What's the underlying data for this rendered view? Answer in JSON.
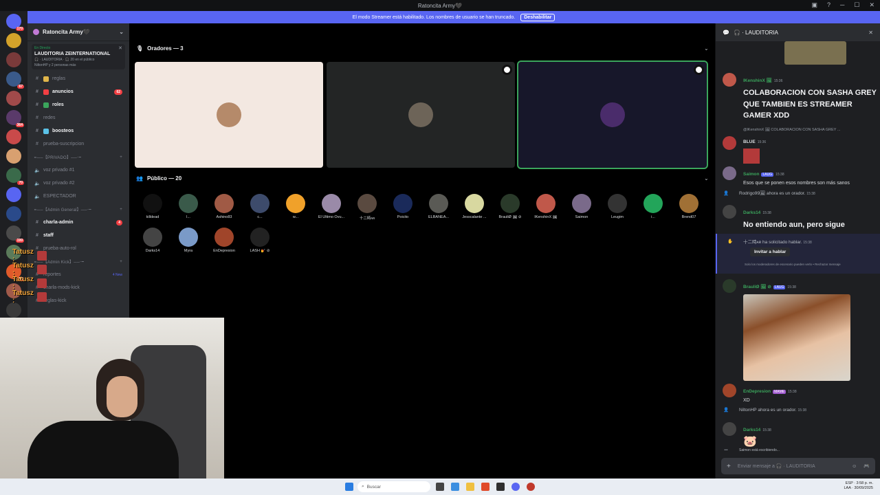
{
  "titlebar": {
    "title": "Ratoncita Army🖤"
  },
  "streamer_banner": {
    "text": "El modo Streamer está habilitado. Los nombres de usuario se han truncado.",
    "button": "Deshabilitar"
  },
  "guild_badges": [
    "170",
    "",
    "",
    "67",
    "",
    "364",
    "",
    "",
    "70",
    "",
    "",
    "199",
    "",
    "19",
    "",
    ""
  ],
  "server": {
    "name": "Ratoncita Army🖤",
    "live_label": "En Directo",
    "stage_title": "LAUDITORIA ZEINTERNATIONAL",
    "stage_sub": "🎧 · LAUDITORIA · 🎧 20 en el público",
    "stage_people": "NiltonHP y 2 personas más"
  },
  "channels": [
    {
      "name": "reglas",
      "bright": false,
      "color": "#e0b54a",
      "count": ""
    },
    {
      "name": "anuncios",
      "bright": true,
      "color": "#f23f43",
      "count": "62"
    },
    {
      "name": "roles",
      "bright": true,
      "color": "#3ba55c",
      "count": ""
    },
    {
      "name": "redes",
      "bright": false,
      "color": "",
      "count": ""
    },
    {
      "name": "boosteos",
      "bright": true,
      "color": "#5bc2e7",
      "count": ""
    },
    {
      "name": "prueba-suscripcion",
      "bright": false,
      "color": "",
      "count": ""
    }
  ],
  "cat_privado": "╾──【PRIVADO】──╼",
  "voice_channels": [
    {
      "name": "voz privado #1"
    },
    {
      "name": "voz privado #2"
    },
    {
      "name": "ESPECTADOR"
    }
  ],
  "cat_admin": "╾──【Admin General】──╼",
  "admin_channels": [
    {
      "name": "charla-admin",
      "bright": true,
      "count": "4"
    },
    {
      "name": "staff",
      "bright": true,
      "count": ""
    },
    {
      "name": "prueba-auto-rol",
      "bright": false,
      "count": ""
    }
  ],
  "cat_kick": "╾──【Admin Kick】──╼",
  "kick_channels": [
    {
      "name": "reportes",
      "tag": "4 New"
    },
    {
      "name": "charla-mods-kick",
      "tag": ""
    },
    {
      "name": "reglas-kick",
      "tag": ""
    }
  ],
  "overlay_names": [
    "Tatusz :",
    "Tatusz :",
    "Tatusz :",
    "Tatusz :"
  ],
  "stage": {
    "speakers_header": "Oradores — 3",
    "audience_header": "Público — 20",
    "speaker_tiles": [
      {
        "bg": "#f3e8e1",
        "avatar": "#b58a6a",
        "highlight": false,
        "pinned": false
      },
      {
        "bg": "#232525",
        "avatar": "#6d6458",
        "highlight": false,
        "pinned": true
      },
      {
        "bg": "#17172a",
        "avatar": "#4a2c6b",
        "highlight": true,
        "pinned": true
      }
    ],
    "audience": [
      {
        "name": "killdead",
        "color": "#111111"
      },
      {
        "name": "l...",
        "color": "#3a5a4a"
      },
      {
        "name": "Ashino83",
        "color": "#a05a45"
      },
      {
        "name": "c...",
        "color": "#3d4b6b"
      },
      {
        "name": "w...",
        "color": "#f0a12a"
      },
      {
        "name": "El Ultimo Ovu...",
        "color": "#9a8aa8"
      },
      {
        "name": "十二時ᴀʀ",
        "color": "#5a4a40"
      },
      {
        "name": "Poicito",
        "color": "#1a2a5a"
      },
      {
        "name": "ELBANEA...",
        "color": "#5a5a55"
      },
      {
        "name": "Jesscalante ...",
        "color": "#d8d8a0"
      },
      {
        "name": "BrauliØ 🖼 ⊘",
        "color": "#2a3a2a"
      },
      {
        "name": "lKenshinX 🖼",
        "color": "#c0584a"
      },
      {
        "name": "Saimon",
        "color": "#7a6a8a"
      },
      {
        "name": "Leugim",
        "color": "#333333"
      },
      {
        "name": "i...",
        "color": "#23a55a"
      },
      {
        "name": "Brend07",
        "color": "#a07035"
      },
      {
        "name": "Darks14",
        "color": "#444444"
      },
      {
        "name": "Myra",
        "color": "#7a9ac8"
      },
      {
        "name": "EnDepresion",
        "color": "#a0452a"
      },
      {
        "name": "LASH 💅 ⊘",
        "color": "#222222"
      }
    ]
  },
  "chat": {
    "header": "🎧 · LAUDITORIA",
    "messages": [
      {
        "name": "lKenshinX 🖼",
        "color": "#3ba55c",
        "time": "15:36",
        "text": "COLABORACION CON SASHA GREY QUE TAMBIEN ES STREAMER GAMER XDD",
        "big": true,
        "avatar": "#c0584a"
      },
      {
        "name": "BLUE",
        "color": "#dbdee1",
        "time": "15:36",
        "reply": "@lKenshinX 🖼 COLABORACION CON SASHA GREY ...",
        "text": "",
        "big": false,
        "avatar": "#b33a3a"
      },
      {
        "name": "Saimon",
        "color": "#3ba55c",
        "time": "15:38",
        "tag": "LAUG",
        "text": "Esos que se ponen esos nombres son más sanos",
        "big": false,
        "avatar": "#7a6a8a"
      },
      {
        "name": "Darks14",
        "color": "#3ba55c",
        "time": "15:38",
        "text": "No entiendo aun, pero sigue",
        "big": true,
        "avatar": "#444444"
      },
      {
        "name": "BrauliØ 🖼 ⊘",
        "color": "#3ba55c",
        "time": "15:38",
        "tag": "LAUG",
        "text": "",
        "big": false,
        "avatar": "#2a3a2a"
      },
      {
        "name": "EnDepresion",
        "color": "#3ba55c",
        "time": "15:38",
        "tag": "MAME",
        "text": "XD",
        "big": false,
        "avatar": "#a0452a"
      },
      {
        "name": "Darks14",
        "color": "#3ba55c",
        "time": "15:38",
        "text": "🐷",
        "big": false,
        "avatar": "#444444"
      }
    ],
    "sys_orador": "Rodrigo99🖼 ahora es un orador.",
    "sys_orador_time": "15:38",
    "request_text": "十二時ᴀʀ ha solicitado hablar.",
    "request_time": "15:38",
    "invite_button": "Invitar a hablar",
    "request_note": "Solo los moderadores de escenario pueden verlo • Rechazar mensaje",
    "sys_nilton": "NiltonHP ahora es un orador.",
    "sys_nilton_time": "15:38",
    "typing": "Saimon está escribiendo...",
    "input_placeholder": "Enviar mensaje a 🎧 · LAUDITORIA"
  },
  "taskbar": {
    "search": "Buscar",
    "lang": "ESP",
    "lang2": "LAA",
    "time": "3:58 p. m.",
    "date": "30/09/2025"
  }
}
